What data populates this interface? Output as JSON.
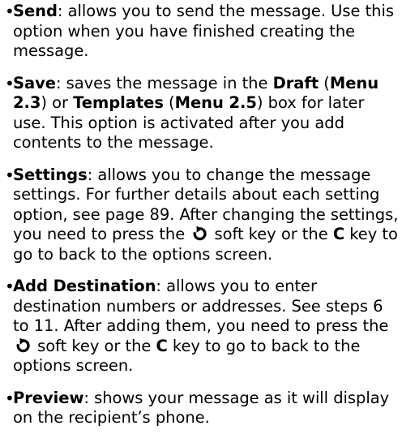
{
  "items": [
    {
      "term": "Send",
      "description": ": allows you to send the message. Use this option when you have finished creating the message."
    },
    {
      "term": "Save",
      "p1": ": saves the message in the ",
      "draft": "Draft",
      "p2": " (",
      "menu_draft": "Menu 2.3",
      "p3": ") or ",
      "templates": "Templates",
      "p4": " (",
      "menu_templates": "Menu 2.5",
      "p5": ") box for later use. This option is activated after you add contents to the message."
    },
    {
      "term": "Settings",
      "p1": ": allows you to change the message settings. For further details about each setting option, see page 89. After changing the settings, you need to press the ",
      "p2": " soft key or the ",
      "key": "C",
      "p3": " key to go to back to the options screen."
    },
    {
      "term": "Add Destination",
      "p1": ": allows you to enter destination numbers or addresses. See steps 6 to 11. After adding them, you need to press the ",
      "p2": " soft key or the ",
      "key": "C",
      "p3": " key to go to back to the options screen."
    },
    {
      "term": "Preview",
      "description": ": shows your message as it will display on the recipient’s phone."
    }
  ],
  "bullet_char": "•",
  "icons": {
    "back_softkey": "back-arrow-softkey-icon"
  }
}
